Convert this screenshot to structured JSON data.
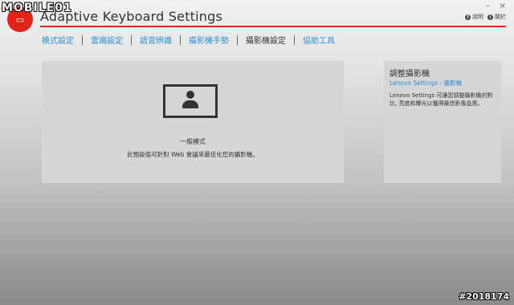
{
  "app": {
    "title": "Adaptive Keyboard Settings"
  },
  "window_controls": {
    "minimize": "–",
    "close": "×"
  },
  "help_links": [
    {
      "icon": "?",
      "label": "說明"
    },
    {
      "icon": "i",
      "label": "關於"
    }
  ],
  "tabs": [
    {
      "label": "模式設定",
      "active": false
    },
    {
      "label": "雲端設定",
      "active": false
    },
    {
      "label": "語音辨識",
      "active": false
    },
    {
      "label": "攝影機手勢",
      "active": false
    },
    {
      "label": "攝影機設定",
      "active": true
    },
    {
      "label": "協助工具",
      "active": false
    }
  ],
  "main": {
    "mode_label": "一般模式",
    "mode_desc": "此預設值可針對 Web 會議來最佳化您的攝影機。"
  },
  "side": {
    "title": "調整攝影機",
    "link": "Lenovo Settings - 攝影機",
    "desc": "Lenovo Settings 可讓您調整攝影機的對比, 亮度和曝光以獲得最佳影像品質。"
  },
  "watermark": {
    "logo": "MOBILE01",
    "id": "#2018174"
  },
  "colors": {
    "accent": "#e2231a",
    "link": "#2b8fd8"
  }
}
